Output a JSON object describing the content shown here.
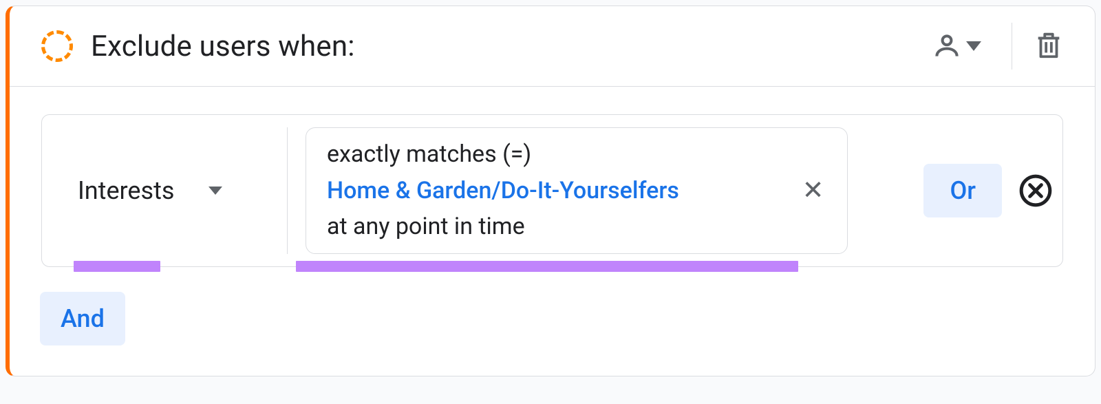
{
  "header": {
    "title": "Exclude users when:"
  },
  "condition": {
    "dimension": "Interests",
    "operator": "exactly matches (=)",
    "value": "Home & Garden/Do-It-Yourselfers",
    "timeframe": "at any point in time"
  },
  "buttons": {
    "or": "Or",
    "and": "And"
  }
}
